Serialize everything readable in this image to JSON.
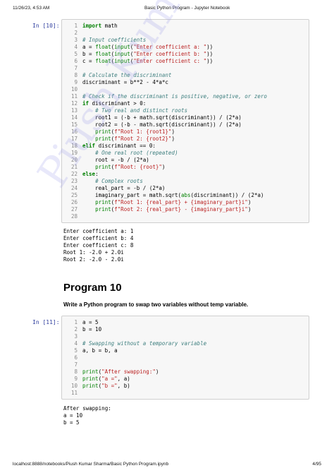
{
  "header": {
    "datetime": "11/26/23, 4:53 AM",
    "title": "Basic Python Program - Jupyter Notebook"
  },
  "footer": {
    "url": "localhost:8888/notebooks/Piush Kumar Sharma/Basic Python Program.ipynb",
    "page": "4/95"
  },
  "watermark": "Piush Kumar Sharma",
  "cell1": {
    "prompt": "In [10]:",
    "lines": [
      "import math",
      "",
      "# Input coefficients",
      "a = float(input(\"Enter coefficient a: \"))",
      "b = float(input(\"Enter coefficient b: \"))",
      "c = float(input(\"Enter coefficient c: \"))",
      "",
      "# Calculate the discriminant",
      "discriminant = b**2 - 4*a*c",
      "",
      "# Check if the discriminant is positive, negative, or zero",
      "if discriminant > 0:",
      "    # Two real and distinct roots",
      "    root1 = (-b + math.sqrt(discriminant)) / (2*a)",
      "    root2 = (-b - math.sqrt(discriminant)) / (2*a)",
      "    print(f\"Root 1: {root1}\")",
      "    print(f\"Root 2: {root2}\")",
      "elif discriminant == 0:",
      "    # One real root (repeated)",
      "    root = -b / (2*a)",
      "    print(f\"Root: {root}\")",
      "else:",
      "    # Complex roots",
      "    real_part = -b / (2*a)",
      "    imaginary_part = math.sqrt(abs(discriminant)) / (2*a)",
      "    print(f\"Root 1: {real_part} + {imaginary_part}i\")",
      "    print(f\"Root 2: {real_part} - {imaginary_part}i\")",
      ""
    ],
    "output": [
      "Enter coefficient a: 1",
      "Enter coefficient b: 4",
      "Enter coefficient c: 8",
      "Root 1: -2.0 + 2.0i",
      "Root 2: -2.0 - 2.0i"
    ]
  },
  "section": {
    "title": "Program 10",
    "task": "Write a Python program to swap two variables without temp variable."
  },
  "cell2": {
    "prompt": "In [11]:",
    "lines": [
      "a = 5",
      "b = 10",
      "",
      "# Swapping without a temporary variable",
      "a, b = b, a",
      "",
      "",
      "print(\"After swapping:\")",
      "print(\"a =\", a)",
      "print(\"b =\", b)",
      ""
    ],
    "output": [
      "After swapping:",
      "a = 10",
      "b = 5"
    ]
  }
}
